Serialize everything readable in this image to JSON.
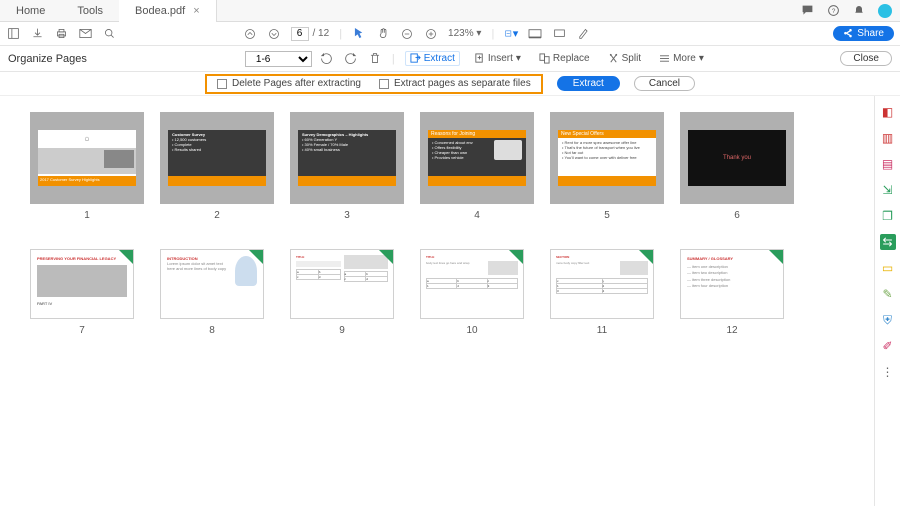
{
  "tabs": {
    "home": "Home",
    "tools": "Tools",
    "doc": "Bodea.pdf"
  },
  "page": {
    "current": "6",
    "total": "/ 12"
  },
  "zoom": "123%",
  "share": "Share",
  "organize": {
    "title": "Organize Pages",
    "range": "1-6",
    "extract": "Extract",
    "insert": "Insert",
    "replace": "Replace",
    "split": "Split",
    "more": "More",
    "close": "Close"
  },
  "options": {
    "delete_after": "Delete Pages after extracting",
    "separate": "Extract pages as separate files",
    "extract_btn": "Extract",
    "cancel_btn": "Cancel"
  },
  "thumbs_row1": [
    "1",
    "2",
    "3",
    "4",
    "5",
    "6"
  ],
  "thumbs_row2": [
    "7",
    "8",
    "9",
    "10",
    "11",
    "12"
  ],
  "slides": {
    "s1_line1": "2017 Customer Survey Highlights",
    "s2_title": "Customer Survey",
    "s3_title": "Survey Demographics – Highlights",
    "s4_title": "Reasons for Joining",
    "s5_title": "New Special Offers",
    "s6_text": "Thank you"
  },
  "side_icons": [
    "pdf-icon",
    "create-icon",
    "edit-icon",
    "export-icon",
    "organize-icon",
    "send-icon",
    "comment-icon",
    "stamp-icon",
    "protect-icon",
    "sign-icon",
    "more-icon"
  ]
}
